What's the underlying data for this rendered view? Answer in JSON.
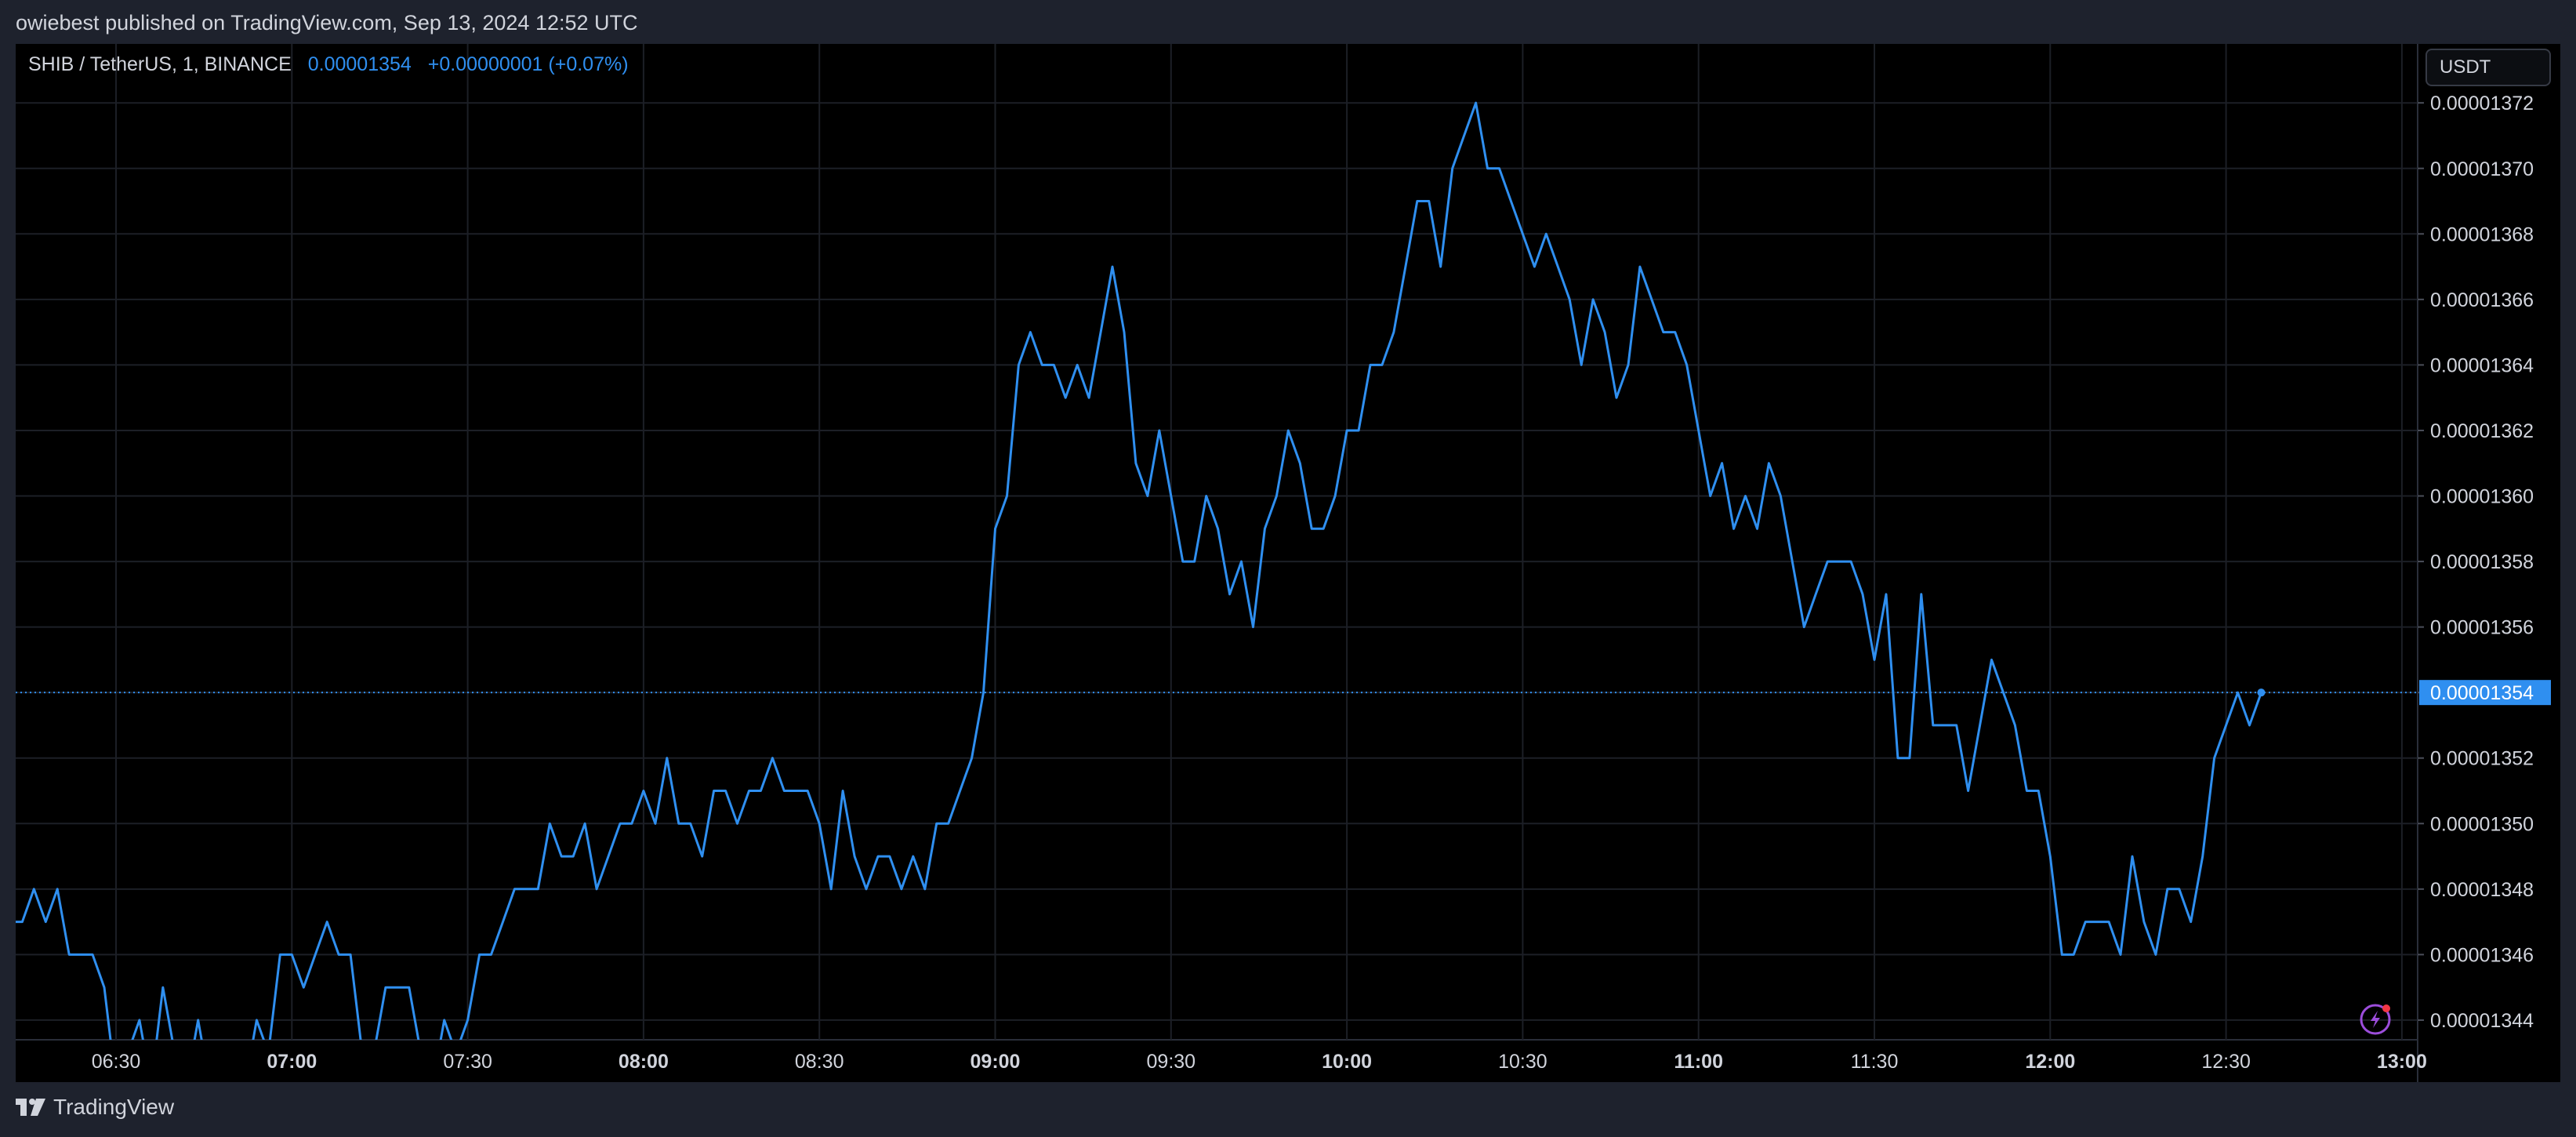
{
  "header": {
    "published_text": "owiebest published on TradingView.com, Sep 13, 2024 12:52 UTC"
  },
  "legend": {
    "symbol": "SHIB / TetherUS, 1, BINANCE",
    "last_price": "0.00001354",
    "change": "+0.00000001 (+0.07%)"
  },
  "price_scale": {
    "currency_button": "USDT",
    "current_price_label": "0.00001354"
  },
  "footer": {
    "brand": "TradingView"
  },
  "colors": {
    "line": "#2f8ff0",
    "background": "#000000",
    "grid": "#1c1f26",
    "axis_text": "#d1d4dc",
    "price_label_bg": "#2f8ff0"
  },
  "icons": {
    "lightning": "lightning-icon",
    "brand_logo": "tradingview-logo-icon"
  },
  "chart_data": {
    "type": "line",
    "title": "SHIB / TetherUS, 1, BINANCE",
    "xlabel": "",
    "ylabel": "",
    "grid": true,
    "x_ticks": [
      {
        "label": "06:30",
        "bold": false
      },
      {
        "label": "07:00",
        "bold": true
      },
      {
        "label": "07:30",
        "bold": false
      },
      {
        "label": "08:00",
        "bold": true
      },
      {
        "label": "08:30",
        "bold": false
      },
      {
        "label": "09:00",
        "bold": true
      },
      {
        "label": "09:30",
        "bold": false
      },
      {
        "label": "10:00",
        "bold": true
      },
      {
        "label": "10:30",
        "bold": false
      },
      {
        "label": "11:00",
        "bold": true
      },
      {
        "label": "11:30",
        "bold": false
      },
      {
        "label": "12:00",
        "bold": true
      },
      {
        "label": "12:30",
        "bold": false
      },
      {
        "label": "13:00",
        "bold": true
      }
    ],
    "y_ticks": [
      "0.00001344",
      "0.00001346",
      "0.00001348",
      "0.00001350",
      "0.00001352",
      "0.00001354",
      "0.00001356",
      "0.00001358",
      "0.00001360",
      "0.00001362",
      "0.00001364",
      "0.00001366",
      "0.00001368",
      "0.00001370",
      "0.00001372"
    ],
    "ylim": [
      1.3434e-05,
      1.3738e-05
    ],
    "current_price": 1.354e-05,
    "series": [
      {
        "x_start": "06:08",
        "x_step_minutes": 2,
        "values": [
          1346,
          1345,
          1347,
          1347,
          1348,
          1347,
          1348,
          1346,
          1346,
          1346,
          1345,
          1342,
          1343,
          1344,
          1342,
          1345,
          1343,
          1342,
          1344,
          1342,
          1343,
          1343,
          1342,
          1344,
          1343,
          1346,
          1346,
          1345,
          1346,
          1347,
          1346,
          1346,
          1343,
          1343,
          1345,
          1345,
          1345,
          1343,
          1342,
          1344,
          1343,
          1344,
          1346,
          1346,
          1347,
          1348,
          1348,
          1348,
          1350,
          1349,
          1349,
          1350,
          1348,
          1349,
          1350,
          1350,
          1351,
          1350,
          1352,
          1350,
          1350,
          1349,
          1351,
          1351,
          1350,
          1351,
          1351,
          1352,
          1351,
          1351,
          1351,
          1350,
          1348,
          1351,
          1349,
          1348,
          1349,
          1349,
          1348,
          1349,
          1348,
          1350,
          1350,
          1351,
          1352,
          1354,
          1359,
          1360,
          1364,
          1365,
          1364,
          1364,
          1363,
          1364,
          1363,
          1365,
          1367,
          1365,
          1361,
          1360,
          1362,
          1360,
          1358,
          1358,
          1360,
          1359,
          1357,
          1358,
          1356,
          1359,
          1360,
          1362,
          1361,
          1359,
          1359,
          1360,
          1362,
          1362,
          1364,
          1364,
          1365,
          1367,
          1369,
          1369,
          1367,
          1370,
          1371,
          1372,
          1370,
          1370,
          1369,
          1368,
          1367,
          1368,
          1367,
          1366,
          1364,
          1366,
          1365,
          1363,
          1364,
          1367,
          1366,
          1365,
          1365,
          1364,
          1362,
          1360,
          1361,
          1359,
          1360,
          1359,
          1361,
          1360,
          1358,
          1356,
          1357,
          1358,
          1358,
          1358,
          1357,
          1355,
          1357,
          1352,
          1352,
          1357,
          1353,
          1353,
          1353,
          1351,
          1353,
          1355,
          1354,
          1353,
          1351,
          1351,
          1349,
          1346,
          1346,
          1347,
          1347,
          1347,
          1346,
          1349,
          1347,
          1346,
          1348,
          1348,
          1347,
          1349,
          1352,
          1353,
          1354,
          1353,
          1354
        ],
        "value_scale": 1e-08
      }
    ]
  }
}
